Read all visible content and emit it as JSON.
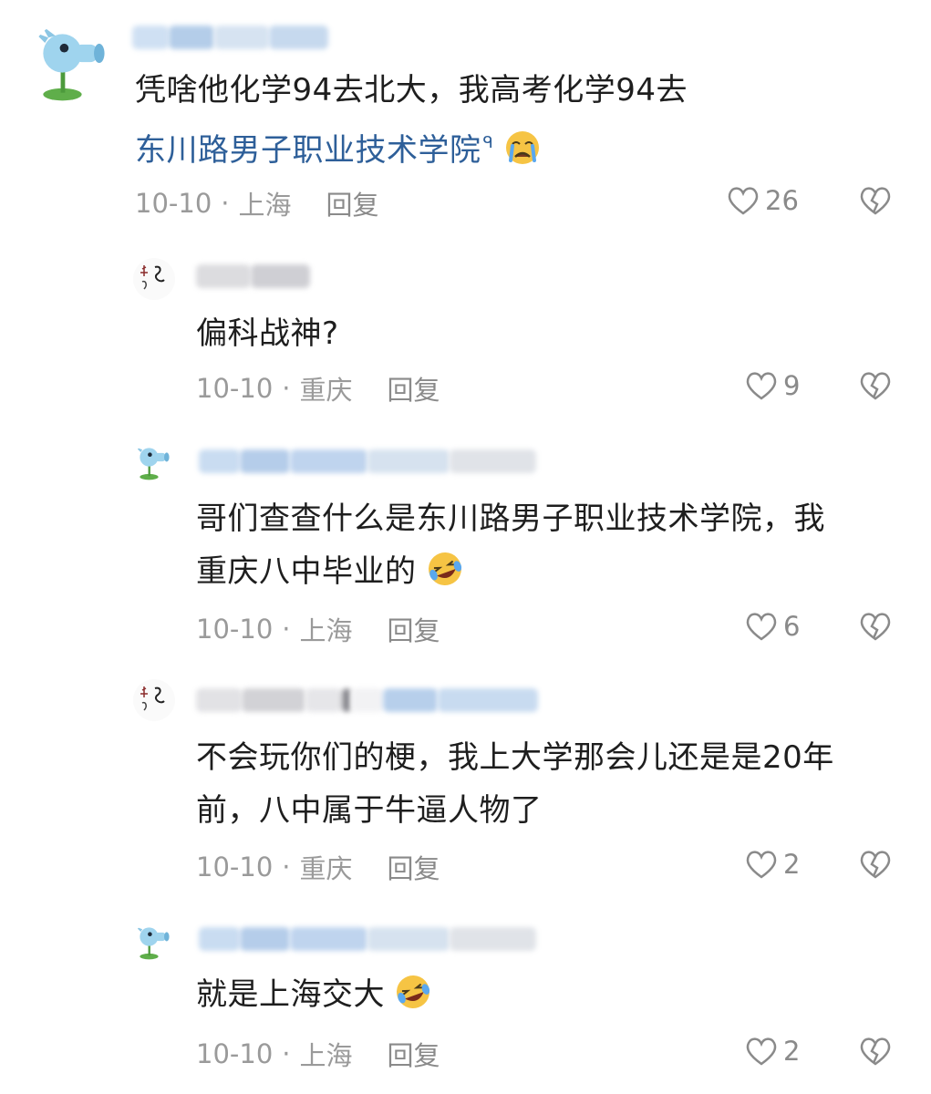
{
  "comments": [
    {
      "avatar": "peashooter-avatar",
      "line1": "凭啥他化学94去北大，我高考化学94去",
      "link_text": "东川路男子职业技术学院",
      "emoji": "crying-face",
      "date": "10-10",
      "location": "上海",
      "reply": "回复",
      "likes": "26"
    },
    {
      "avatar": "calligraphy-avatar",
      "line1": "偏科战神?",
      "date": "10-10",
      "location": "重庆",
      "reply": "回复",
      "likes": "9"
    },
    {
      "avatar": "peashooter-avatar",
      "line1": "哥们查查什么是东川路男子职业技术学院，我",
      "line2": "重庆八中毕业的",
      "emoji": "rofl-face",
      "date": "10-10",
      "location": "上海",
      "reply": "回复",
      "likes": "6"
    },
    {
      "avatar": "calligraphy-avatar",
      "line1": "不会玩你们的梗，我上大学那会儿还是是20年",
      "line2": "前，八中属于牛逼人物了",
      "date": "10-10",
      "location": "重庆",
      "reply": "回复",
      "likes": "2"
    },
    {
      "avatar": "peashooter-avatar",
      "line1": "就是上海交大",
      "emoji": "rofl-face",
      "date": "10-10",
      "location": "上海",
      "reply": "回复",
      "likes": "2"
    }
  ],
  "colors": {
    "link": "#2e5f99",
    "meta": "#9a9a9a",
    "blur_blue": "#b9d3f0",
    "blur_gray": "#d8d8dc"
  }
}
